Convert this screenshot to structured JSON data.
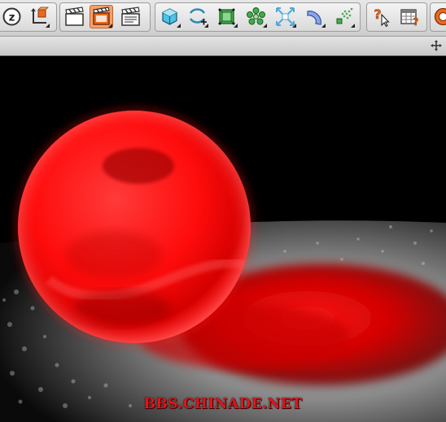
{
  "toolbar": {
    "groups": [
      {
        "name": "tool-group-1"
      },
      {
        "name": "tool-group-2"
      },
      {
        "name": "tool-group-3"
      },
      {
        "name": "tool-group-4"
      },
      {
        "name": "tool-group-5"
      }
    ],
    "icons": [
      "zoom-icon",
      "axis-icon",
      "render-view-icon",
      "render-active-view-icon",
      "render-settings-icon",
      "cube-icon",
      "nurbs-icon",
      "subdivision-icon",
      "cloner-icon",
      "deformer-icon",
      "spline-icon",
      "particle-icon",
      "help-cursor-icon",
      "table-help-icon",
      "world-icon"
    ],
    "active_icon": "render-active-view-icon",
    "colors": {
      "orange": "#e86a1e",
      "active_bg": "#f4a16c",
      "cyan": "#4fc3e8",
      "green": "#3fae49"
    }
  },
  "viewport": {
    "scene": "red-translucent-sphere",
    "colors": {
      "sphere": "#ff0f0f",
      "floor": "#9a9a9a",
      "shadow": "#b00000",
      "background": "#000000"
    }
  },
  "watermark": {
    "text": "BBS.CHINADE.NET",
    "color": "#e0151a"
  }
}
